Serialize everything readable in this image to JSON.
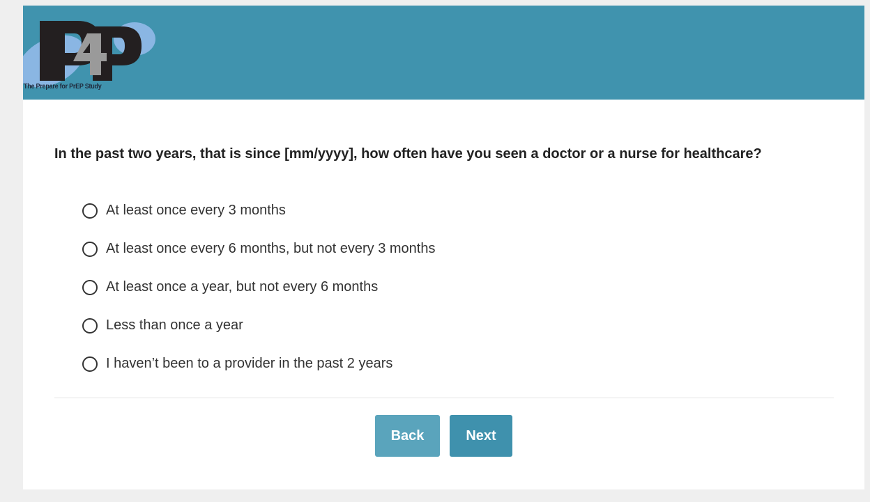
{
  "header": {
    "logo_caption": "The Prepare for PrEP Study",
    "logo_text": "P4P",
    "background_color": "#4093ae"
  },
  "survey": {
    "question": "In the past two years, that is since [mm/yyyy], how often have you seen a doctor or a nurse for healthcare?",
    "options": [
      {
        "label": "At least once every 3 months",
        "selected": false
      },
      {
        "label": "At least once every 6 months, but not every 3 months",
        "selected": false
      },
      {
        "label": "At least once a year, but not every 6 months",
        "selected": false
      },
      {
        "label": "Less than once a year",
        "selected": false
      },
      {
        "label": "I haven’t been to a provider in the past 2 years",
        "selected": false
      }
    ]
  },
  "navigation": {
    "back_label": "Back",
    "next_label": "Next"
  }
}
